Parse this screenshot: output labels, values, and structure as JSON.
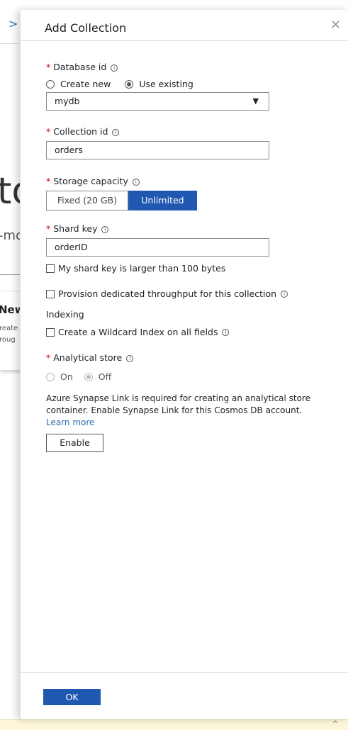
{
  "background": {
    "chevron": ">",
    "big_text": "to",
    "sub_text": "-mo",
    "card_title": "New",
    "card_line1": "reate",
    "card_line2": "roug"
  },
  "panel": {
    "title": "Add Collection",
    "close": "×"
  },
  "database": {
    "label": "Database id",
    "create_new_label": "Create new",
    "use_existing_label": "Use existing",
    "selected_mode": "Use existing",
    "value": "mydb",
    "dropdown_arrow": "▼"
  },
  "collection": {
    "label": "Collection id",
    "value": "orders"
  },
  "storage": {
    "label": "Storage capacity",
    "fixed_label": "Fixed (20 GB)",
    "unlimited_label": "Unlimited",
    "selected": "Unlimited"
  },
  "shard": {
    "label": "Shard key",
    "value": "orderID",
    "large_key_label": "My shard key is larger than 100 bytes"
  },
  "throughput": {
    "label": "Provision dedicated throughput for this collection"
  },
  "indexing": {
    "heading": "Indexing",
    "wildcard_label": "Create a Wildcard Index on all fields"
  },
  "analytical": {
    "label": "Analytical store",
    "on_label": "On",
    "off_label": "Off",
    "selected": "Off",
    "note": "Azure Synapse Link is required for creating an analytical store container. Enable Synapse Link for this Cosmos DB account.",
    "link_text": "Learn more",
    "enable_label": "Enable"
  },
  "footer": {
    "ok_label": "OK"
  },
  "colors": {
    "primary": "#2058b1",
    "required": "#c00000",
    "link": "#2b6cb0"
  },
  "icons": {
    "info": "info-circle-icon",
    "close": "close-icon",
    "dropdown": "caret-down-icon"
  }
}
